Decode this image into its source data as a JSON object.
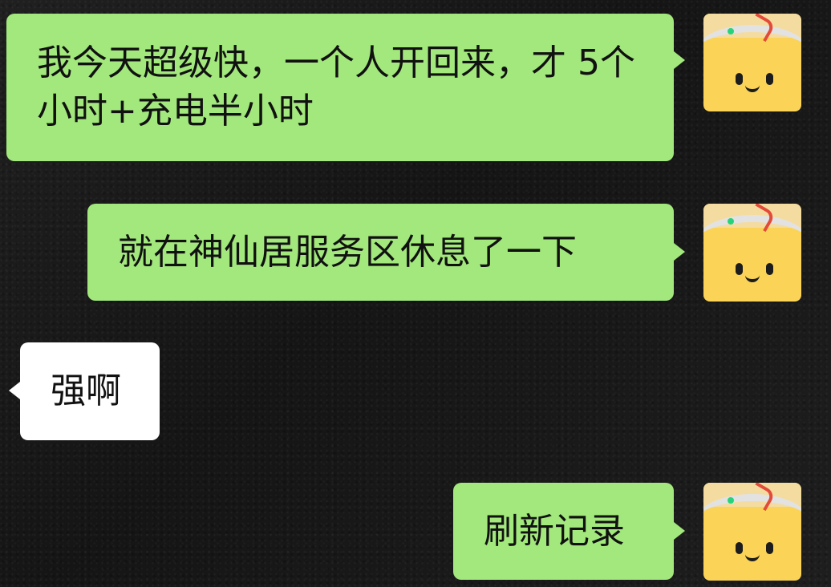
{
  "messages": [
    {
      "side": "right",
      "text": "我今天超级快，一个人开回来，才 5个小时+充电半小时",
      "avatar": "smiley-avatar-icon"
    },
    {
      "side": "right",
      "text": "就在神仙居服务区休息了一下",
      "avatar": "smiley-avatar-icon"
    },
    {
      "side": "left",
      "text": "强啊"
    },
    {
      "side": "right",
      "text": "刷新记录",
      "avatar": "smiley-avatar-icon"
    }
  ],
  "colors": {
    "my_bubble": "#a2e87c",
    "other_bubble": "#ffffff",
    "avatar_background": "#fbd457"
  }
}
